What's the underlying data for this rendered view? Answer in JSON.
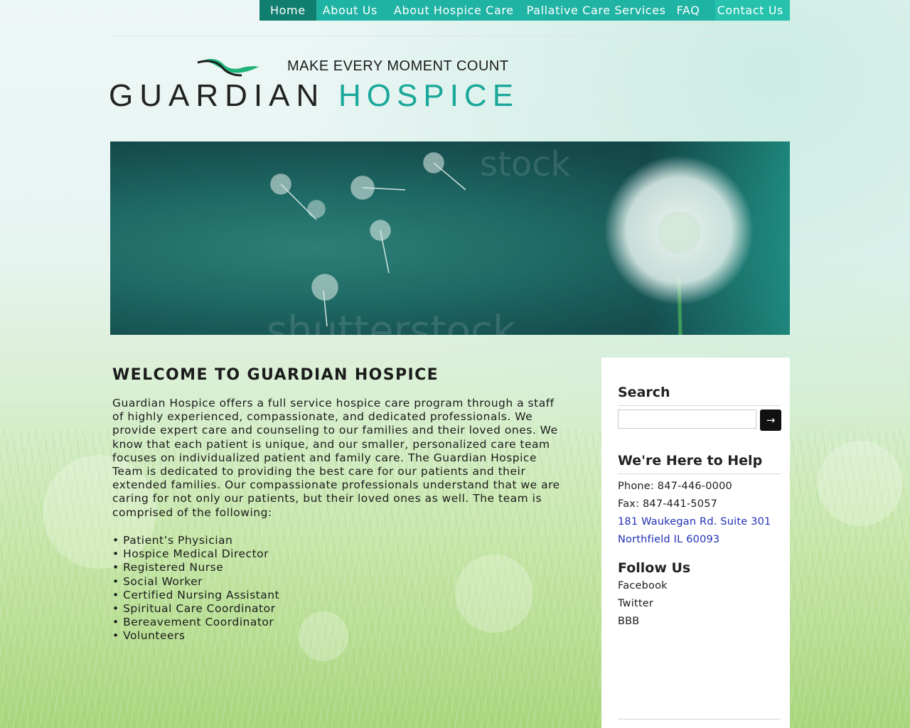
{
  "nav": {
    "items": [
      {
        "label": "Home",
        "active": true
      },
      {
        "label": "About Us"
      },
      {
        "label": "About Hospice Care"
      },
      {
        "label": "Pallative Care Services"
      },
      {
        "label": "FAQ"
      },
      {
        "label": "Contact Us"
      }
    ]
  },
  "header": {
    "tagline": "MAKE EVERY MOMENT COUNT",
    "logo_word1": "GUARDIAN",
    "logo_word2": "HOSPICE"
  },
  "banner": {
    "watermark_top": "stock",
    "watermark_bottom": "shutterstock"
  },
  "main": {
    "heading": "WELCOME TO GUARDIAN HOSPICE",
    "intro": "Guardian Hospice offers a full service hospice care program through a staff of highly experienced, compassionate, and dedicated professionals. We provide expert care and counseling to our families and their loved ones. We know that each patient is unique, and our smaller, personalized care team focuses on individualized patient and family care. The Guardian Hospice Team is dedicated to providing the best care for our patients and their extended families. Our compassionate professionals understand that we are caring for not only our patients, but their loved ones as well. The team is comprised of the following:",
    "team": [
      "• Patient’s Physician",
      "• Hospice Medical Director",
      "• Registered Nurse",
      "• Social Worker",
      "• Certified Nursing Assistant",
      "• Spiritual Care Coordinator",
      "• Bereavement Coordinator",
      "• Volunteers"
    ]
  },
  "sidebar": {
    "search_title": "Search",
    "search_placeholder": "",
    "search_button": "→",
    "help_title": "We're Here to Help",
    "phone": "Phone: 847-446-0000",
    "fax": "Fax: 847-441-5057",
    "address_line1": "181 Waukegan Rd. Suite 301",
    "address_line2": "Northfield IL 60093",
    "follow_title": "Follow Us",
    "follow_links": [
      "Facebook",
      "Twitter",
      "BBB"
    ]
  },
  "colors": {
    "nav_bg": "#1fb3a3",
    "nav_active": "#117f70",
    "brand_teal": "#1aa89a",
    "link_blue": "#1f2fb5"
  }
}
